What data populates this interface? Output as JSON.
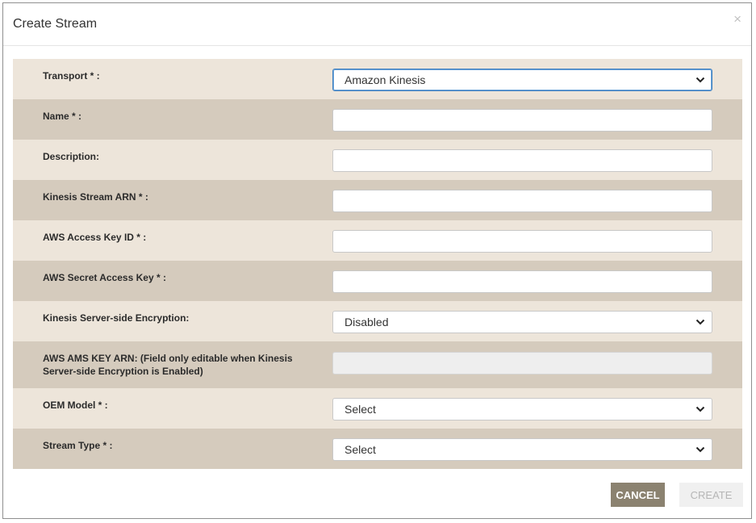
{
  "dialog": {
    "title": "Create Stream",
    "close_glyph": "×"
  },
  "fields": [
    {
      "label": "Transport * :",
      "type": "select",
      "value": "Amazon Kinesis"
    },
    {
      "label": "Name * :",
      "type": "text",
      "value": ""
    },
    {
      "label": "Description:",
      "type": "text",
      "value": ""
    },
    {
      "label": "Kinesis Stream ARN * :",
      "type": "text",
      "value": ""
    },
    {
      "label": "AWS Access Key ID * :",
      "type": "text",
      "value": ""
    },
    {
      "label": "AWS Secret Access Key * :",
      "type": "text",
      "value": ""
    },
    {
      "label": "Kinesis Server-side Encryption:",
      "type": "select",
      "value": "Disabled"
    },
    {
      "label": "AWS AMS KEY ARN: (Field only editable when Kinesis Server-side Encryption is Enabled)",
      "type": "text",
      "disabled": true,
      "value": ""
    },
    {
      "label": "OEM Model * :",
      "type": "select",
      "value": "Select"
    },
    {
      "label": "Stream Type * :",
      "type": "select",
      "value": "Select"
    }
  ],
  "footer": {
    "cancel_label": "CANCEL",
    "create_label": "CREATE"
  },
  "colors": {
    "row_light": "#ede5da",
    "row_dark": "#d5cbbd",
    "cancel_bg": "#8b8270",
    "focus_border": "#3d7ebf"
  },
  "icons": {
    "close": "close-icon",
    "dropdown": "chevron-down-icon"
  }
}
